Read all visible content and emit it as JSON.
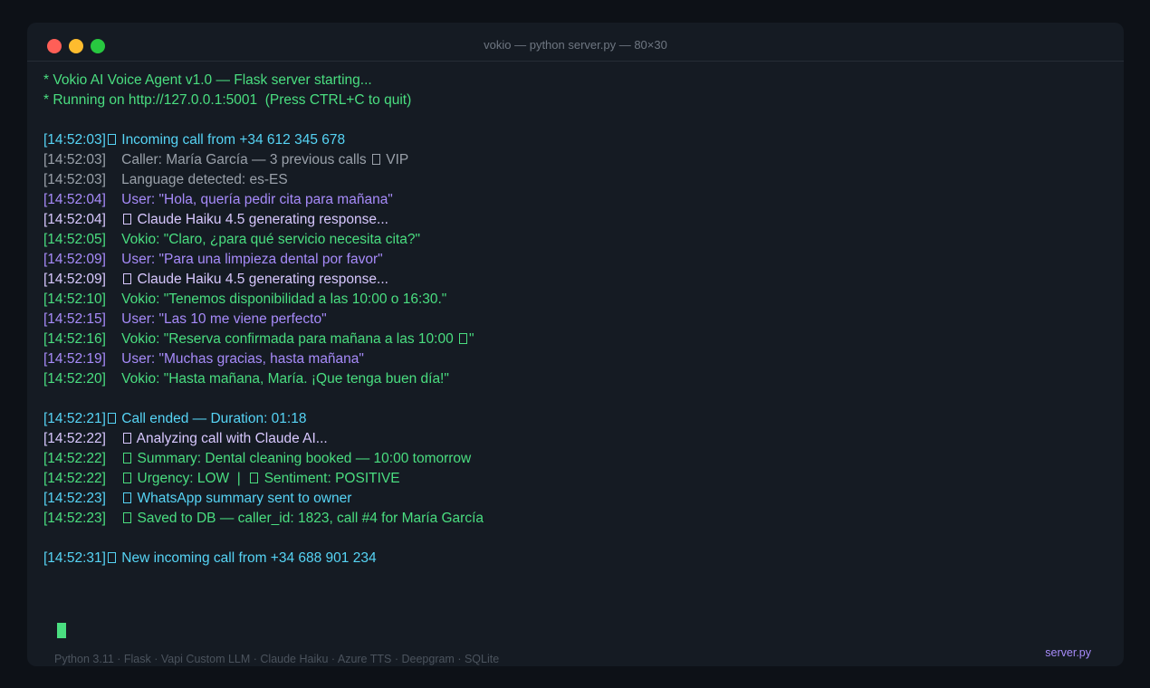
{
  "window": {
    "title": "vokio — python server.py — 80×30"
  },
  "colors": {
    "green": "#4ade80",
    "cyan": "#56d4f5",
    "gray": "#9aa1aa",
    "purple": "#a78bfa",
    "lavender": "#d8c8ff"
  },
  "log": {
    "boot1": "* Vokio AI Voice Agent v1.0 — Flask server starting...",
    "boot2": "* Running on http://127.0.0.1:5001  (Press CTRL+C to quit)",
    "l1": {
      "ts": "[14:52:03]",
      "text": " Incoming call from +34 612 345 678"
    },
    "l2": {
      "ts": "[14:52:03]",
      "text": "    Caller: María García — 3 previous calls ",
      "tail": " VIP"
    },
    "l3": {
      "ts": "[14:52:03]",
      "text": "    Language detected: es-ES"
    },
    "l4": {
      "ts": "[14:52:04]",
      "text": "    User: \"Hola, quería pedir cita para mañana\""
    },
    "l5": {
      "ts": "[14:52:04]",
      "text": " Claude Haiku 4.5 generating response..."
    },
    "l6": {
      "ts": "[14:52:05]",
      "text": "    Vokio: \"Claro, ¿para qué servicio necesita cita?\""
    },
    "l7": {
      "ts": "[14:52:09]",
      "text": "    User: \"Para una limpieza dental por favor\""
    },
    "l8": {
      "ts": "[14:52:09]",
      "text": " Claude Haiku 4.5 generating response..."
    },
    "l9": {
      "ts": "[14:52:10]",
      "text": "    Vokio: \"Tenemos disponibilidad a las 10:00 o 16:30.\""
    },
    "l10": {
      "ts": "[14:52:15]",
      "text": "    User: \"Las 10 me viene perfecto\""
    },
    "l11": {
      "ts": "[14:52:16]",
      "text": "    Vokio: \"Reserva confirmada para mañana a las 10:00 ",
      "tail": "\""
    },
    "l12": {
      "ts": "[14:52:19]",
      "text": "    User: \"Muchas gracias, hasta mañana\""
    },
    "l13": {
      "ts": "[14:52:20]",
      "text": "    Vokio: \"Hasta mañana, María. ¡Que tenga buen día!\""
    },
    "l14": {
      "ts": "[14:52:21]",
      "text": " Call ended — Duration: 01:18"
    },
    "l15": {
      "ts": "[14:52:22]",
      "text": " Analyzing call with Claude AI..."
    },
    "l16": {
      "ts": "[14:52:22]",
      "text": " Summary: Dental cleaning booked — 10:00 tomorrow"
    },
    "l17": {
      "ts": "[14:52:22]",
      "text": " Urgency: LOW  |  ",
      "tail": " Sentiment: POSITIVE"
    },
    "l18": {
      "ts": "[14:52:23]",
      "text": " WhatsApp summary sent to owner"
    },
    "l19": {
      "ts": "[14:52:23]",
      "text": " Saved to DB — caller_id: 1823, call #4 for María García"
    },
    "l20": {
      "ts": "[14:52:31]",
      "text": " New incoming call from +34 688 901 234"
    }
  },
  "footer": {
    "stack": "Python 3.11 · Flask · Vapi Custom LLM · Claude Haiku · Azure TTS · Deepgram · SQLite",
    "file": "server.py"
  }
}
